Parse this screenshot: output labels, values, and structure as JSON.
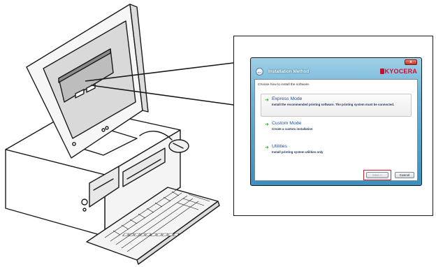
{
  "window": {
    "title": "Installation Method",
    "brand": "KYOCERA",
    "close_glyph": "x",
    "instruction": "Choose how to install the software."
  },
  "options": [
    {
      "name": "Express Mode",
      "description": "Install the recommended printing software. The printing system must be connected.",
      "icon": "green-arrow-icon"
    },
    {
      "name": "Custom Mode",
      "description": "Create a custom installation",
      "icon": "green-arrow-icon"
    },
    {
      "name": "Utilities",
      "description": "Install printing system utilities only",
      "icon": "green-arrow-icon"
    }
  ],
  "buttons": {
    "next": "Next >",
    "cancel": "Cancel"
  },
  "colors": {
    "brand_red": "#c8102e",
    "option_blue": "#1f4e96",
    "arrow_green": "#3aa63a",
    "highlight_red": "#d81e2c"
  }
}
